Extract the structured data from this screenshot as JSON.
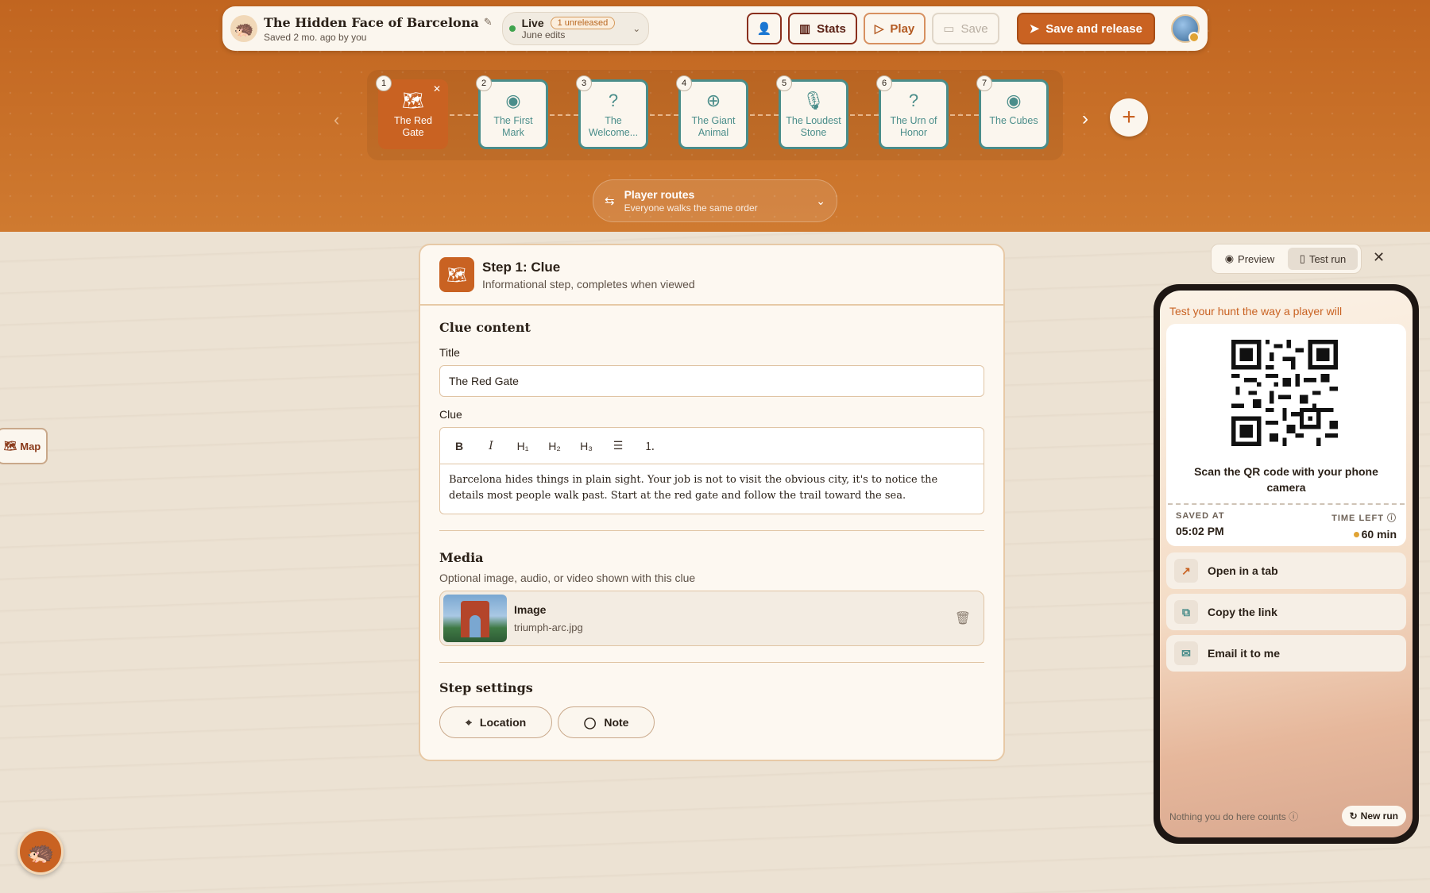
{
  "header": {
    "title": "The Hidden Face of Barcelona",
    "saved": "Saved 2 mo. ago by you",
    "status": "Live",
    "unreleased": "1 unreleased",
    "edits": "June edits",
    "stats_label": "Stats",
    "play_label": "Play",
    "save_label": "Save",
    "release_label": "Save and release"
  },
  "steps": [
    {
      "num": "1",
      "label": "The Red Gate",
      "icon": "map-icon"
    },
    {
      "num": "2",
      "label": "The First Mark",
      "icon": "camera-icon"
    },
    {
      "num": "3",
      "label": "The Welcome...",
      "icon": "question-icon"
    },
    {
      "num": "4",
      "label": "The Giant Animal",
      "icon": "crosshair-icon"
    },
    {
      "num": "5",
      "label": "The Loudest Stone",
      "icon": "microphone-icon"
    },
    {
      "num": "6",
      "label": "The Urn of Honor",
      "icon": "question-icon"
    },
    {
      "num": "7",
      "label": "The Cubes",
      "icon": "camera-icon"
    }
  ],
  "routes": {
    "title": "Player routes",
    "subtitle": "Everyone walks the same order"
  },
  "card": {
    "step_title": "Step 1: Clue",
    "step_sub": "Informational step, completes when viewed",
    "clue_content": "Clue content",
    "title_label": "Title",
    "title_value": "The Red Gate",
    "clue_label": "Clue",
    "clue_text": "Barcelona hides things in plain sight. Your job is not to visit the obvious city, it's to notice the details most people walk past. Start at the red gate and follow the trail toward the sea.",
    "media_title": "Media",
    "media_sub": "Optional image, audio, or video shown with this clue",
    "media_type": "Image",
    "media_file": "triumph-arc.jpg",
    "settings_title": "Step settings",
    "location_label": "Location",
    "note_label": "Note"
  },
  "map_label": "Map",
  "preview": {
    "preview_label": "Preview",
    "test_label": "Test run",
    "phone_head": "Test your hunt the way a player will",
    "scan_text": "Scan the QR code with your phone camera",
    "saved_cap": "SAVED AT",
    "saved_val": "05:02 PM",
    "time_cap": "TIME LEFT",
    "time_val": "60 min",
    "open_tab": "Open in a tab",
    "copy_link": "Copy the link",
    "email": "Email it to me",
    "footnote": "Nothing you do here counts",
    "new_run": "New run"
  },
  "colors": {
    "brand": "#c96222",
    "teal": "#4a8d8a",
    "live": "#3fa34d"
  }
}
